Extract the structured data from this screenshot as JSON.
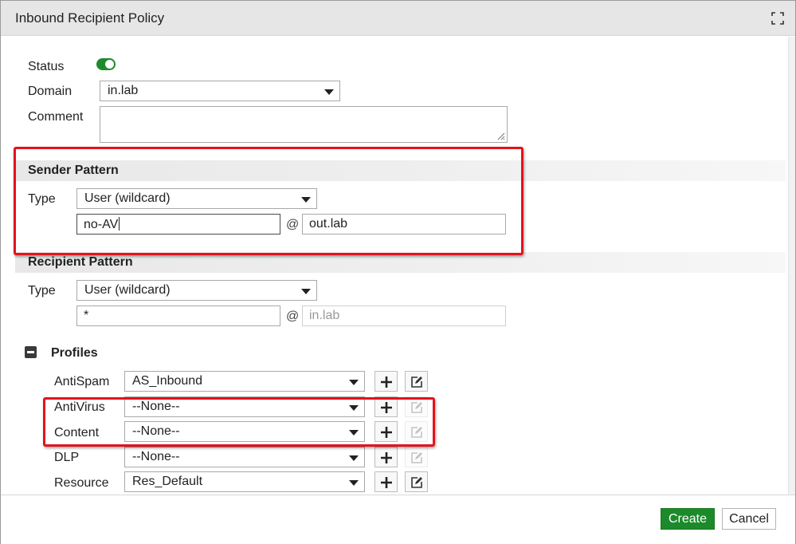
{
  "dialog": {
    "title": "Inbound Recipient Policy"
  },
  "form": {
    "status_label": "Status",
    "status_enabled": true,
    "domain_label": "Domain",
    "domain_value": "in.lab",
    "comment_label": "Comment",
    "comment_value": ""
  },
  "sender_pattern": {
    "heading": "Sender Pattern",
    "type_label": "Type",
    "type_value": "User (wildcard)",
    "user_value": "no-AV",
    "at": "@",
    "domain_value": "out.lab"
  },
  "recipient_pattern": {
    "heading": "Recipient Pattern",
    "type_label": "Type",
    "type_value": "User (wildcard)",
    "user_value": "*",
    "at": "@",
    "domain_value": "in.lab"
  },
  "profiles": {
    "heading": "Profiles",
    "rows": [
      {
        "label": "AntiSpam",
        "value": "AS_Inbound",
        "edit_enabled": true
      },
      {
        "label": "AntiVirus",
        "value": "--None--",
        "edit_enabled": false
      },
      {
        "label": "Content",
        "value": "--None--",
        "edit_enabled": false
      },
      {
        "label": "DLP",
        "value": "--None--",
        "edit_enabled": false
      },
      {
        "label": "Resource",
        "value": "Res_Default",
        "edit_enabled": true
      }
    ]
  },
  "footer": {
    "create_label": "Create",
    "cancel_label": "Cancel"
  },
  "colors": {
    "accent_green": "#1c8a2a",
    "highlight_red": "#e3131b"
  },
  "icons": [
    "maximize-icon",
    "toggle-switch",
    "chevron-down-icon",
    "resize-grip-icon",
    "collapse-minus-icon",
    "plus-icon",
    "edit-icon"
  ]
}
